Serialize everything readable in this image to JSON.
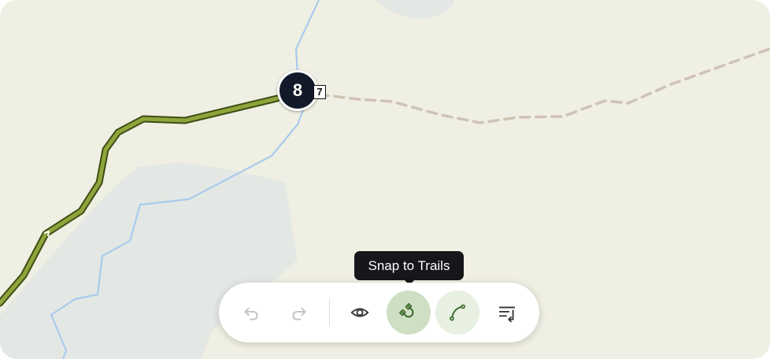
{
  "map": {
    "waypoint": {
      "number": "8",
      "next_label": "7"
    },
    "colors": {
      "land": "#f0efe3",
      "water_area": "#e4e8e4",
      "stream": "#a9cbee",
      "route": "#8fa43a",
      "route_outline": "#3e4e16",
      "unpaved_trail": "#cfc3b5",
      "waypoint_fill": "#121a2a"
    }
  },
  "tooltip": {
    "text": "Snap to Trails"
  },
  "toolbar": {
    "tools": [
      {
        "id": "undo",
        "icon": "undo-icon",
        "state": "disabled"
      },
      {
        "id": "redo",
        "icon": "redo-icon",
        "state": "disabled"
      },
      {
        "id": "preview",
        "icon": "eye-icon",
        "state": "enabled"
      },
      {
        "id": "snap_to_trails",
        "icon": "magnet-icon",
        "state": "active"
      },
      {
        "id": "draw_curve",
        "icon": "curve-icon",
        "state": "active"
      },
      {
        "id": "reverse_route",
        "icon": "list-reverse-icon",
        "state": "enabled"
      }
    ]
  }
}
